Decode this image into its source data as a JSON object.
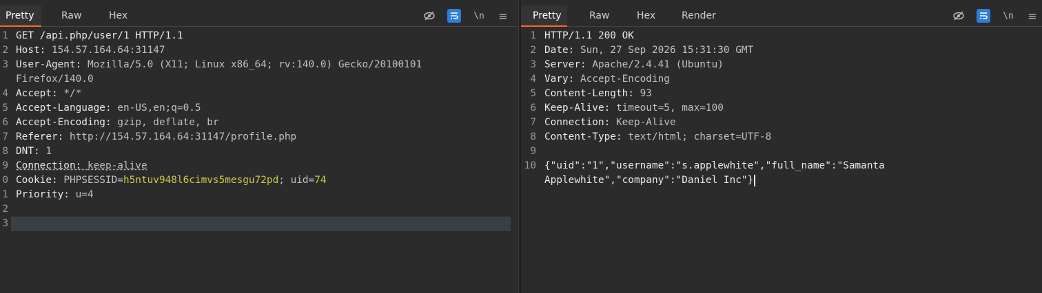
{
  "left": {
    "tabs": [
      "Pretty",
      "Raw",
      "Hex"
    ],
    "active_tab": "Pretty",
    "tools": [
      {
        "name": "eye-slash-icon",
        "glyph": "⊘"
      },
      {
        "name": "wrap-icon",
        "glyph": "⇉"
      },
      {
        "name": "newline-icon",
        "glyph": "\\n"
      },
      {
        "name": "menu-icon",
        "glyph": "≡"
      }
    ],
    "lines": [
      {
        "n": "1",
        "parts": [
          {
            "t": "GET /api.php/user/1 HTTP/1.1",
            "c": "key"
          }
        ]
      },
      {
        "n": "2",
        "parts": [
          {
            "t": "Host: ",
            "c": "key"
          },
          {
            "t": "154.57.164.64:31147",
            "c": "val"
          }
        ]
      },
      {
        "n": "3",
        "parts": [
          {
            "t": "User-Agent: ",
            "c": "key"
          },
          {
            "t": "Mozilla/5.0 (X11; Linux x86_64; rv:140.0) Gecko/20100101",
            "c": "val"
          }
        ]
      },
      {
        "n": "",
        "parts": [
          {
            "t": "Firefox/140.0",
            "c": "val"
          }
        ]
      },
      {
        "n": "4",
        "parts": [
          {
            "t": "Accept: ",
            "c": "key"
          },
          {
            "t": "*/*",
            "c": "val"
          }
        ]
      },
      {
        "n": "5",
        "parts": [
          {
            "t": "Accept-Language: ",
            "c": "key"
          },
          {
            "t": "en-US,en;q=0.5",
            "c": "val"
          }
        ]
      },
      {
        "n": "6",
        "parts": [
          {
            "t": "Accept-Encoding: ",
            "c": "key"
          },
          {
            "t": "gzip, deflate, br",
            "c": "val"
          }
        ]
      },
      {
        "n": "7",
        "parts": [
          {
            "t": "Referer: ",
            "c": "key"
          },
          {
            "t": "http://154.57.164.64:31147/profile.php",
            "c": "val"
          }
        ]
      },
      {
        "n": "8",
        "parts": [
          {
            "t": "DNT: ",
            "c": "key"
          },
          {
            "t": "1",
            "c": "val"
          }
        ]
      },
      {
        "n": "9",
        "parts": [
          {
            "t": "Connection: ",
            "c": "key dotted"
          },
          {
            "t": "keep-alive",
            "c": "val dotted"
          }
        ]
      },
      {
        "n": "0",
        "parts": [
          {
            "t": "Cookie: ",
            "c": "key"
          },
          {
            "t": "PHPSESSID",
            "c": "val"
          },
          {
            "t": "=",
            "c": "val"
          },
          {
            "t": "h5ntuv948l6cimvs5mesgu72pd",
            "c": "hl"
          },
          {
            "t": "; ",
            "c": "val"
          },
          {
            "t": "uid",
            "c": "val"
          },
          {
            "t": "=",
            "c": "val"
          },
          {
            "t": "74",
            "c": "hl"
          }
        ]
      },
      {
        "n": "1",
        "parts": [
          {
            "t": "Priority: ",
            "c": "key"
          },
          {
            "t": "u=4",
            "c": "val"
          }
        ]
      },
      {
        "n": "2",
        "parts": []
      },
      {
        "n": "3",
        "parts": []
      }
    ]
  },
  "right": {
    "tabs": [
      "Pretty",
      "Raw",
      "Hex",
      "Render"
    ],
    "active_tab": "Pretty",
    "tools": [
      {
        "name": "eye-slash-icon",
        "glyph": "⊘"
      },
      {
        "name": "wrap-icon",
        "glyph": "⇉"
      },
      {
        "name": "newline-icon",
        "glyph": "\\n"
      },
      {
        "name": "menu-icon",
        "glyph": "≡"
      }
    ],
    "lines": [
      {
        "n": "1",
        "parts": [
          {
            "t": "HTTP/1.1 200 OK",
            "c": "key"
          }
        ]
      },
      {
        "n": "2",
        "parts": [
          {
            "t": "Date: ",
            "c": "key"
          },
          {
            "t": "Sun, 27 Sep 2026 15:31:30 GMT",
            "c": "val"
          }
        ]
      },
      {
        "n": "3",
        "parts": [
          {
            "t": "Server: ",
            "c": "key"
          },
          {
            "t": "Apache/2.4.41 (Ubuntu)",
            "c": "val"
          }
        ]
      },
      {
        "n": "4",
        "parts": [
          {
            "t": "Vary: ",
            "c": "key"
          },
          {
            "t": "Accept-Encoding",
            "c": "val"
          }
        ]
      },
      {
        "n": "5",
        "parts": [
          {
            "t": "Content-Length: ",
            "c": "key"
          },
          {
            "t": "93",
            "c": "val"
          }
        ]
      },
      {
        "n": "6",
        "parts": [
          {
            "t": "Keep-Alive: ",
            "c": "key"
          },
          {
            "t": "timeout=5, max=100",
            "c": "val"
          }
        ]
      },
      {
        "n": "7",
        "parts": [
          {
            "t": "Connection: ",
            "c": "key"
          },
          {
            "t": "Keep-Alive",
            "c": "val"
          }
        ]
      },
      {
        "n": "8",
        "parts": [
          {
            "t": "Content-Type: ",
            "c": "key"
          },
          {
            "t": "text/html; charset=UTF-8",
            "c": "val"
          }
        ]
      },
      {
        "n": "9",
        "parts": []
      },
      {
        "n": "10",
        "parts": [
          {
            "t": "{\"uid\":\"1\",\"username\":\"s.applewhite\",\"full_name\":\"Samanta",
            "c": "key"
          }
        ]
      },
      {
        "n": "",
        "parts": [
          {
            "t": "Applewhite\",\"company\":\"Daniel Inc\"}",
            "c": "key"
          }
        ],
        "cursor": true
      }
    ]
  }
}
